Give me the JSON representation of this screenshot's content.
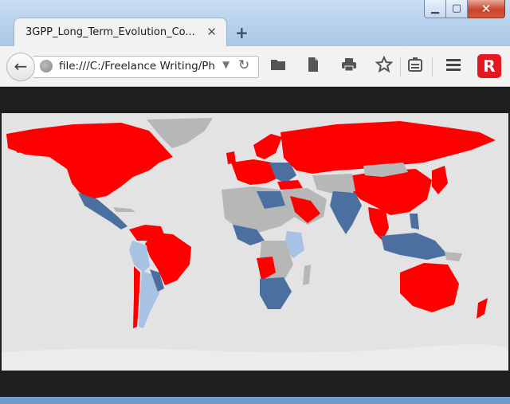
{
  "window": {
    "minimize_glyph": "▁",
    "maximize_glyph": "▢",
    "close_glyph": "✕"
  },
  "tab": {
    "title": "3GPP_Long_Term_Evolution_Co...",
    "close_glyph": "✕",
    "new_tab_glyph": "+"
  },
  "navbar": {
    "back_glyph": "←",
    "url": "file:///C:/Freelance Writing/Ph",
    "dropdown_glyph": "▼",
    "reload_glyph": "↻",
    "toolbar_icons": [
      "folder-icon",
      "document-icon",
      "print-icon",
      "bookmark-star-icon",
      "reading-list-icon",
      "menu-icon",
      "avira-icon"
    ],
    "avira_label": "R"
  },
  "map": {
    "colors": {
      "ocean": "#e3e3e3",
      "no_data": "#b7b7b7",
      "red": "#ff0000",
      "dark_blue": "#4a6fa0",
      "light_blue": "#a8c2e4"
    }
  }
}
